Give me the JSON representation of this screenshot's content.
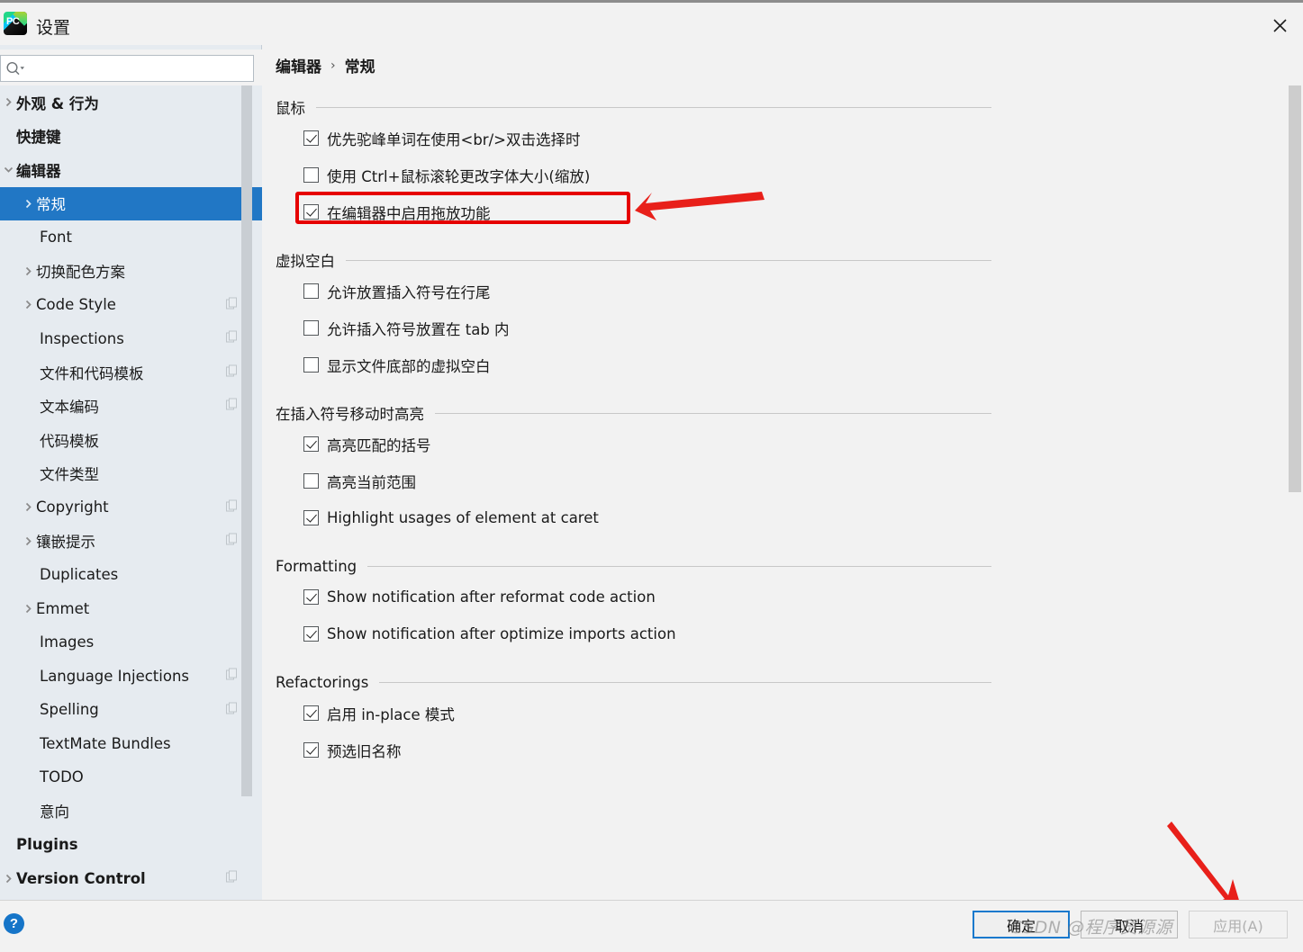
{
  "window": {
    "title": "设置",
    "app_icon": "pycharm-icon",
    "close_label": "✕"
  },
  "search": {
    "placeholder": "",
    "value": "",
    "icon": "search-icon"
  },
  "sidebar": {
    "items": [
      {
        "label": "外观 & 行为",
        "level": 0,
        "arrow": "collapsed",
        "bold": true,
        "copy": false,
        "selected": false
      },
      {
        "label": "快捷键",
        "level": 0,
        "arrow": "none",
        "bold": true,
        "copy": false,
        "selected": false
      },
      {
        "label": "编辑器",
        "level": 0,
        "arrow": "expanded",
        "bold": true,
        "copy": false,
        "selected": false
      },
      {
        "label": "常规",
        "level": 1,
        "arrow": "collapsed",
        "bold": false,
        "copy": false,
        "selected": true
      },
      {
        "label": "Font",
        "level": 1,
        "arrow": "none",
        "bold": false,
        "copy": false,
        "selected": false
      },
      {
        "label": "切换配色方案",
        "level": 1,
        "arrow": "collapsed",
        "bold": false,
        "copy": false,
        "selected": false
      },
      {
        "label": "Code Style",
        "level": 1,
        "arrow": "collapsed",
        "bold": false,
        "copy": true,
        "selected": false
      },
      {
        "label": "Inspections",
        "level": 1,
        "arrow": "none",
        "bold": false,
        "copy": true,
        "selected": false
      },
      {
        "label": "文件和代码模板",
        "level": 1,
        "arrow": "none",
        "bold": false,
        "copy": true,
        "selected": false
      },
      {
        "label": "文本编码",
        "level": 1,
        "arrow": "none",
        "bold": false,
        "copy": true,
        "selected": false
      },
      {
        "label": "代码模板",
        "level": 1,
        "arrow": "none",
        "bold": false,
        "copy": false,
        "selected": false
      },
      {
        "label": "文件类型",
        "level": 1,
        "arrow": "none",
        "bold": false,
        "copy": false,
        "selected": false
      },
      {
        "label": "Copyright",
        "level": 1,
        "arrow": "collapsed",
        "bold": false,
        "copy": true,
        "selected": false
      },
      {
        "label": "镶嵌提示",
        "level": 1,
        "arrow": "collapsed",
        "bold": false,
        "copy": true,
        "selected": false
      },
      {
        "label": "Duplicates",
        "level": 1,
        "arrow": "none",
        "bold": false,
        "copy": false,
        "selected": false
      },
      {
        "label": "Emmet",
        "level": 1,
        "arrow": "collapsed",
        "bold": false,
        "copy": false,
        "selected": false
      },
      {
        "label": "Images",
        "level": 1,
        "arrow": "none",
        "bold": false,
        "copy": false,
        "selected": false
      },
      {
        "label": "Language Injections",
        "level": 1,
        "arrow": "none",
        "bold": false,
        "copy": true,
        "selected": false
      },
      {
        "label": "Spelling",
        "level": 1,
        "arrow": "none",
        "bold": false,
        "copy": true,
        "selected": false
      },
      {
        "label": "TextMate Bundles",
        "level": 1,
        "arrow": "none",
        "bold": false,
        "copy": false,
        "selected": false
      },
      {
        "label": "TODO",
        "level": 1,
        "arrow": "none",
        "bold": false,
        "copy": false,
        "selected": false
      },
      {
        "label": "意向",
        "level": 1,
        "arrow": "none",
        "bold": false,
        "copy": false,
        "selected": false
      },
      {
        "label": "Plugins",
        "level": 0,
        "arrow": "none",
        "bold": true,
        "copy": false,
        "selected": false
      },
      {
        "label": "Version Control",
        "level": 0,
        "arrow": "collapsed",
        "bold": true,
        "copy": true,
        "selected": false
      }
    ]
  },
  "breadcrumb": {
    "parent": "编辑器",
    "separator": "›",
    "current": "常规"
  },
  "sections": [
    {
      "title": "鼠标",
      "options": [
        {
          "label": "优先驼峰单词在使用<br/>双击选择时",
          "checked": true
        },
        {
          "label": "使用 Ctrl+鼠标滚轮更改字体大小(缩放)",
          "checked": false,
          "highlighted": true
        },
        {
          "label": "在编辑器中启用拖放功能",
          "checked": true
        }
      ]
    },
    {
      "title": "虚拟空白",
      "options": [
        {
          "label": "允许放置插入符号在行尾",
          "checked": false
        },
        {
          "label": "允许插入符号放置在 tab 内",
          "checked": false
        },
        {
          "label": "显示文件底部的虚拟空白",
          "checked": false
        }
      ]
    },
    {
      "title": "在插入符号移动时高亮",
      "options": [
        {
          "label": "高亮匹配的括号",
          "checked": true
        },
        {
          "label": "高亮当前范围",
          "checked": false
        },
        {
          "label": "Highlight usages of element at caret",
          "checked": true
        }
      ]
    },
    {
      "title": "Formatting",
      "options": [
        {
          "label": "Show notification after reformat code action",
          "checked": true
        },
        {
          "label": "Show notification after optimize imports action",
          "checked": true
        }
      ]
    },
    {
      "title": "Refactorings",
      "options": [
        {
          "label": "启用 in-place 模式",
          "checked": true
        },
        {
          "label": "预选旧名称",
          "checked": true
        }
      ]
    }
  ],
  "footer": {
    "help_label": "?",
    "ok_label": "确定",
    "cancel_label": "取消",
    "apply_label": "应用(A)"
  },
  "watermark": "CSDN @程序员源源",
  "annotations": {
    "highlight_color": "#e60000",
    "arrow_color": "#e8201a",
    "accent_color": "#2177c5"
  }
}
